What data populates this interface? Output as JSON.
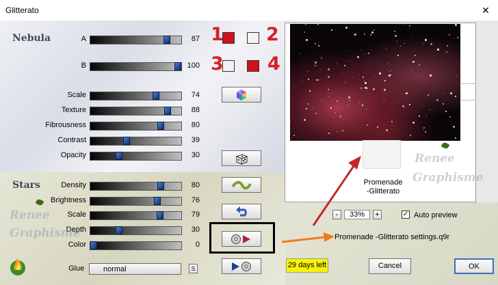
{
  "window": {
    "title": "Glitterato",
    "close": "✕"
  },
  "nebula": {
    "heading": "Nebula",
    "sliders": [
      {
        "label": "A",
        "value": "87",
        "level": 0.87
      },
      {
        "label": "B",
        "value": "100",
        "level": 1.0
      },
      {
        "label": "Scale",
        "value": "74",
        "level": 0.74
      },
      {
        "label": "Texture",
        "value": "88",
        "level": 0.88
      },
      {
        "label": "Fibrousness",
        "value": "80",
        "level": 0.8
      },
      {
        "label": "Contrast",
        "value": "39",
        "level": 0.39
      },
      {
        "label": "Opacity",
        "value": "30",
        "level": 0.3
      }
    ]
  },
  "stars": {
    "heading": "Stars",
    "sliders": [
      {
        "label": "Density",
        "value": "80",
        "level": 0.8
      },
      {
        "label": "Brightness",
        "value": "76",
        "level": 0.76
      },
      {
        "label": "Scale",
        "value": "79",
        "level": 0.79
      },
      {
        "label": "Depth",
        "value": "30",
        "level": 0.3
      },
      {
        "label": "Color",
        "value": "0",
        "level": 0.0
      }
    ]
  },
  "glue": {
    "label": "Glue",
    "value": "normal",
    "btn": "S"
  },
  "swatches": {
    "colors": {
      "red": "#d0111b",
      "white": "#f2f2f2"
    },
    "markers": [
      "1",
      "2",
      "3",
      "4"
    ]
  },
  "watermark": {
    "line1": "Renee",
    "line2": "Graphisme"
  },
  "preset": {
    "name": "Promenade\n-Glitterato",
    "file": "Promenade -Glitterato settings.q9r"
  },
  "zoom": {
    "minus": "-",
    "value": "33%",
    "plus": "+"
  },
  "auto_preview": {
    "label": "Auto preview",
    "checked": true
  },
  "trial": {
    "text": "29 days left"
  },
  "buttons": {
    "cancel": "Cancel",
    "ok": "OK"
  }
}
